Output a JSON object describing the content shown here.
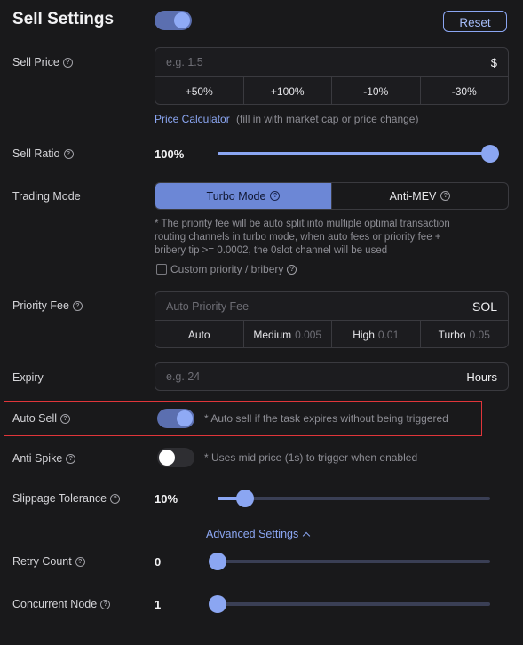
{
  "header": {
    "title": "Sell Settings",
    "reset_label": "Reset",
    "main_toggle_on": true
  },
  "sell_price": {
    "label": "Sell Price",
    "placeholder": "e.g. 1.5",
    "unit": "$",
    "presets": [
      "+50%",
      "+100%",
      "-10%",
      "-30%"
    ],
    "calculator_link": "Price Calculator",
    "calculator_hint": "(fill in with market cap or price change)"
  },
  "sell_ratio": {
    "label": "Sell Ratio",
    "value": "100%",
    "fraction": 1.0
  },
  "trading_mode": {
    "label": "Trading Mode",
    "modes": [
      "Turbo Mode",
      "Anti-MEV"
    ],
    "selected": "Turbo Mode",
    "note_line1": "* The priority fee will be auto split into multiple optimal transaction",
    "note_line2": "routing channels in turbo mode, when auto fees or priority fee +",
    "note_line3": "bribery tip >= 0.0002, the 0slot channel will be used",
    "custom_label": "Custom priority / bribery",
    "custom_checked": false
  },
  "priority_fee": {
    "label": "Priority Fee",
    "placeholder": "Auto Priority Fee",
    "unit": "SOL",
    "options": [
      {
        "label": "Auto",
        "value": ""
      },
      {
        "label": "Medium",
        "value": "0.005"
      },
      {
        "label": "High",
        "value": "0.01"
      },
      {
        "label": "Turbo",
        "value": "0.05"
      }
    ]
  },
  "expiry": {
    "label": "Expiry",
    "placeholder": "e.g. 24",
    "unit": "Hours"
  },
  "auto_sell": {
    "label": "Auto Sell",
    "on": true,
    "note": "* Auto sell if the task expires without being triggered"
  },
  "anti_spike": {
    "label": "Anti Spike",
    "on": false,
    "note": "* Uses mid price (1s) to trigger when enabled"
  },
  "slippage": {
    "label": "Slippage Tolerance",
    "value": "10%",
    "fraction": 0.1
  },
  "advanced": {
    "label": "Advanced Settings"
  },
  "retry_count": {
    "label": "Retry Count",
    "value": "0",
    "fraction": 0
  },
  "concurrent_node": {
    "label": "Concurrent Node",
    "value": "1",
    "fraction": 0
  },
  "colors": {
    "accent": "#8ba6f2",
    "background": "#19191b",
    "highlight_border": "#e0353a"
  },
  "icons": {
    "help": "question-circle-icon",
    "chevron": "chevron-up-icon"
  }
}
